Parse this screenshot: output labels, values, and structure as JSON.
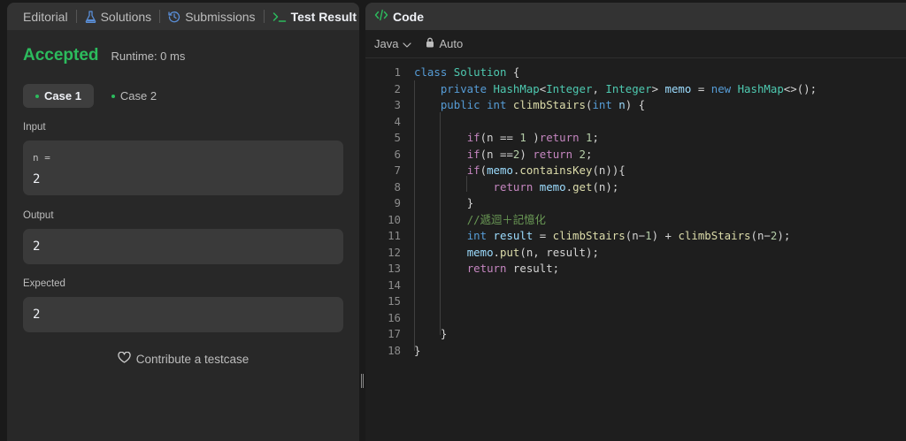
{
  "left_tabs": [
    {
      "label": "Editorial",
      "icon": "editorial"
    },
    {
      "label": "Solutions",
      "icon": "flask-icon"
    },
    {
      "label": "Submissions",
      "icon": "history-icon"
    },
    {
      "label": "Test Result",
      "icon": "terminal-icon",
      "active": true
    }
  ],
  "result": {
    "status": "Accepted",
    "runtime": "Runtime: 0 ms"
  },
  "cases": [
    "Case 1",
    "Case 2"
  ],
  "input": {
    "label": "Input",
    "var_name": "n =",
    "value": "2"
  },
  "output": {
    "label": "Output",
    "value": "2"
  },
  "expected": {
    "label": "Expected",
    "value": "2"
  },
  "contribute_label": "Contribute a testcase",
  "code_panel": {
    "title": "Code",
    "language": "Java",
    "mode": "Auto"
  },
  "code_lines": [
    [
      [
        "class ",
        "kb"
      ],
      [
        "Solution ",
        "ty"
      ],
      [
        "{",
        "pl"
      ]
    ],
    [
      [
        "    "
      ],
      [
        "private ",
        "kb"
      ],
      [
        "HashMap",
        "ty"
      ],
      [
        "<",
        "pl"
      ],
      [
        "Integer",
        "ty"
      ],
      [
        ", ",
        "pl"
      ],
      [
        "Integer",
        "ty"
      ],
      [
        "> ",
        "pl"
      ],
      [
        "memo ",
        "vr"
      ],
      [
        "= ",
        "pl"
      ],
      [
        "new ",
        "kb"
      ],
      [
        "HashMap",
        "ty"
      ],
      [
        "<>();",
        "pl"
      ]
    ],
    [
      [
        "    "
      ],
      [
        "public ",
        "kb"
      ],
      [
        "int ",
        "kb"
      ],
      [
        "climbStairs",
        "fn"
      ],
      [
        "(",
        "pl"
      ],
      [
        "int ",
        "kb"
      ],
      [
        "n",
        "vr"
      ],
      [
        ") {",
        "pl"
      ]
    ],
    [
      [
        ""
      ]
    ],
    [
      [
        "        "
      ],
      [
        "if",
        "kw"
      ],
      [
        "(n == ",
        "pl"
      ],
      [
        "1 ",
        "nm"
      ],
      [
        ")",
        "pl"
      ],
      [
        "return ",
        "kw"
      ],
      [
        "1",
        "nm"
      ],
      [
        ";",
        "pl"
      ]
    ],
    [
      [
        "        "
      ],
      [
        "if",
        "kw"
      ],
      [
        "(n ==",
        "pl"
      ],
      [
        "2",
        "nm"
      ],
      [
        ") ",
        "pl"
      ],
      [
        "return ",
        "kw"
      ],
      [
        "2",
        "nm"
      ],
      [
        ";",
        "pl"
      ]
    ],
    [
      [
        "        "
      ],
      [
        "if",
        "kw"
      ],
      [
        "(",
        "pl"
      ],
      [
        "memo",
        "vr"
      ],
      [
        ".",
        "pl"
      ],
      [
        "containsKey",
        "fn"
      ],
      [
        "(n)){",
        "pl"
      ]
    ],
    [
      [
        "            "
      ],
      [
        "return ",
        "kw"
      ],
      [
        "memo",
        "vr"
      ],
      [
        ".",
        "pl"
      ],
      [
        "get",
        "fn"
      ],
      [
        "(n);",
        "pl"
      ]
    ],
    [
      [
        "        "
      ],
      [
        "}",
        "pl"
      ]
    ],
    [
      [
        "        "
      ],
      [
        "//遞迴＋記憶化",
        "cm"
      ]
    ],
    [
      [
        "        "
      ],
      [
        "int ",
        "kb"
      ],
      [
        "result ",
        "vr"
      ],
      [
        "= ",
        "pl"
      ],
      [
        "climbStairs",
        "fn"
      ],
      [
        "(n",
        "pl"
      ],
      [
        "−",
        "pl"
      ],
      [
        "1",
        "nm"
      ],
      [
        ") + ",
        "pl"
      ],
      [
        "climbStairs",
        "fn"
      ],
      [
        "(n",
        "pl"
      ],
      [
        "−",
        "pl"
      ],
      [
        "2",
        "nm"
      ],
      [
        ");",
        "pl"
      ]
    ],
    [
      [
        "        "
      ],
      [
        "memo",
        "vr"
      ],
      [
        ".",
        "pl"
      ],
      [
        "put",
        "fn"
      ],
      [
        "(n, result);",
        "pl"
      ]
    ],
    [
      [
        "        "
      ],
      [
        "return ",
        "kw"
      ],
      [
        "result;",
        "pl"
      ]
    ],
    [
      [
        ""
      ]
    ],
    [
      [
        ""
      ]
    ],
    [
      [
        ""
      ]
    ],
    [
      [
        "    "
      ],
      [
        "}",
        "pl"
      ]
    ],
    [
      [
        "}",
        "pl"
      ]
    ]
  ]
}
